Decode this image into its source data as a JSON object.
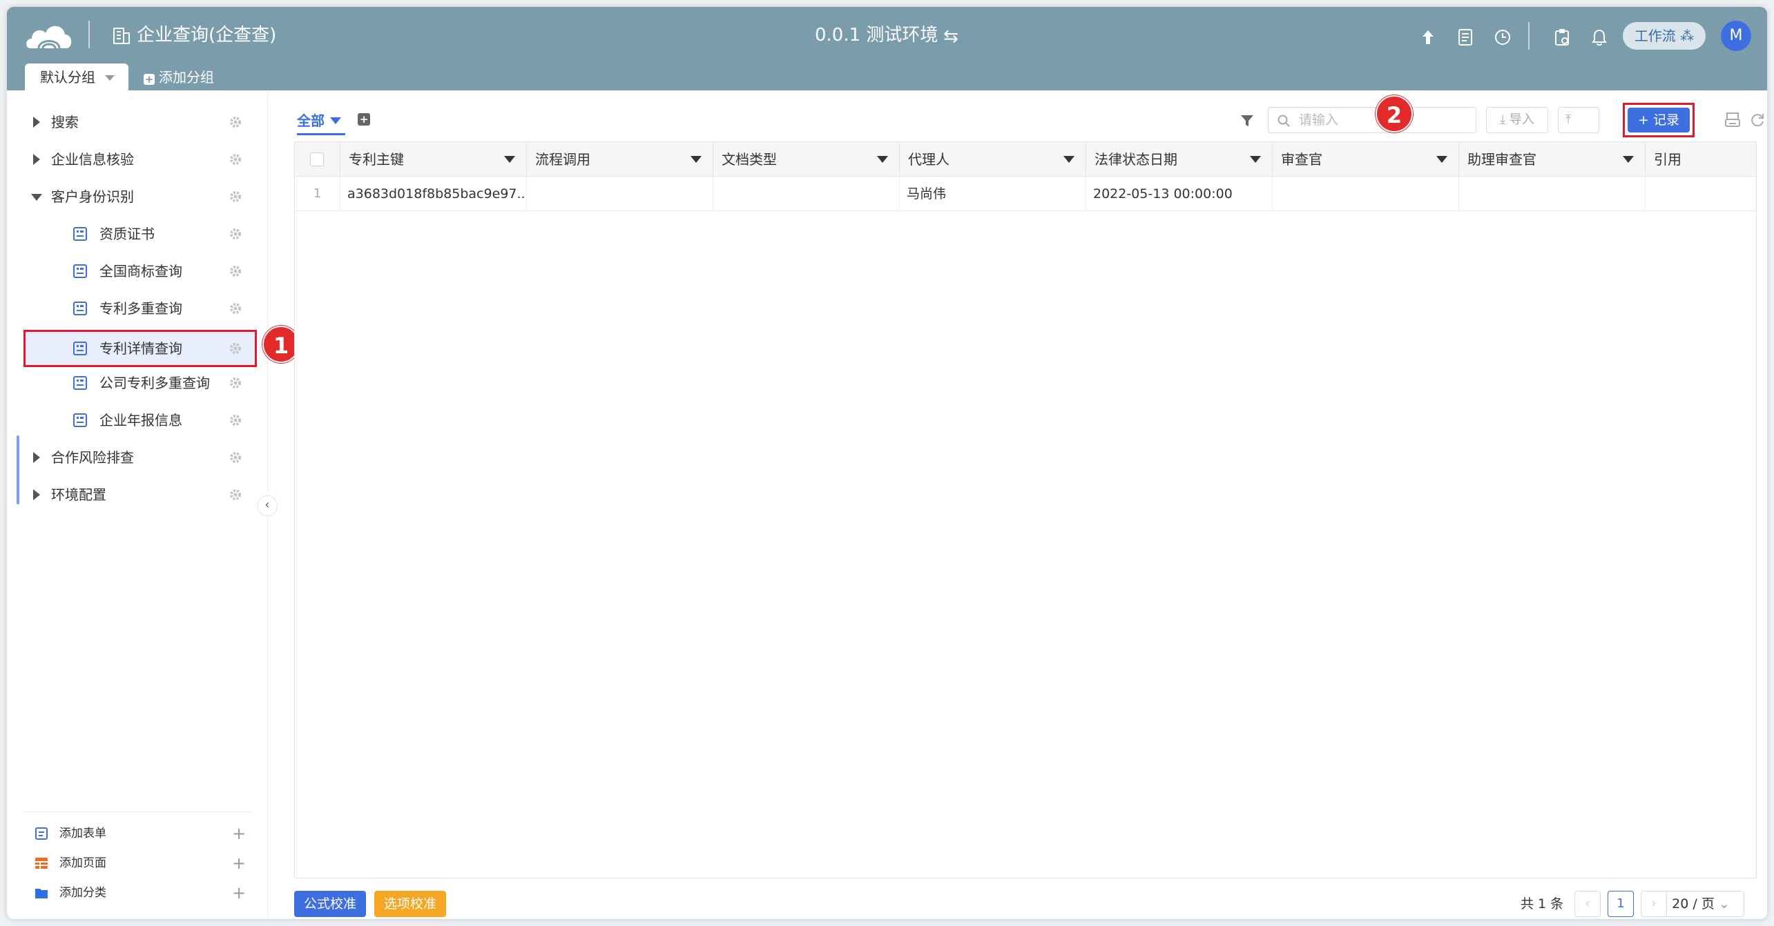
{
  "header": {
    "app_title": "企业查询(企查查)",
    "env_title": "0.0.1 测试环境",
    "workflow_label": "工作流",
    "avatar_letter": "M",
    "bg_color": "#7b9cab"
  },
  "group_tabs": {
    "active": "默认分组",
    "add": "添加分组"
  },
  "sidebar": {
    "items": [
      {
        "label": "搜索"
      },
      {
        "label": "企业信息核验"
      },
      {
        "label": "客户身份识别"
      },
      {
        "label": "资质证书"
      },
      {
        "label": "全国商标查询"
      },
      {
        "label": "专利多重查询"
      },
      {
        "label": "专利详情查询"
      },
      {
        "label": "公司专利多重查询"
      },
      {
        "label": "企业年报信息"
      },
      {
        "label": "合作风险排查"
      },
      {
        "label": "环境配置"
      }
    ],
    "bottom": [
      {
        "label": "添加表单"
      },
      {
        "label": "添加页面"
      },
      {
        "label": "添加分类"
      }
    ]
  },
  "badges": {
    "one": "1",
    "two": "2"
  },
  "toolbar": {
    "view_tab": "全部",
    "search_placeholder": "请输入",
    "import_label": "导入",
    "record_label": "+ 记录",
    "accent": "#3d6fe0"
  },
  "table": {
    "columns": [
      "专利主键",
      "流程调用",
      "文档类型",
      "代理人",
      "法律状态日期",
      "审查官",
      "助理审查官",
      "引用"
    ],
    "rows": [
      {
        "num": "1",
        "cells": [
          "a3683d018f8b85bac9e97...",
          "",
          "",
          "马尚伟",
          "2022-05-13 00:00:00",
          "",
          "",
          ""
        ]
      }
    ]
  },
  "footer": {
    "formula_check": "公式校准",
    "option_check": "选项校准",
    "total": "共 1 条",
    "current_page": "1",
    "page_size": "20 / 页"
  }
}
